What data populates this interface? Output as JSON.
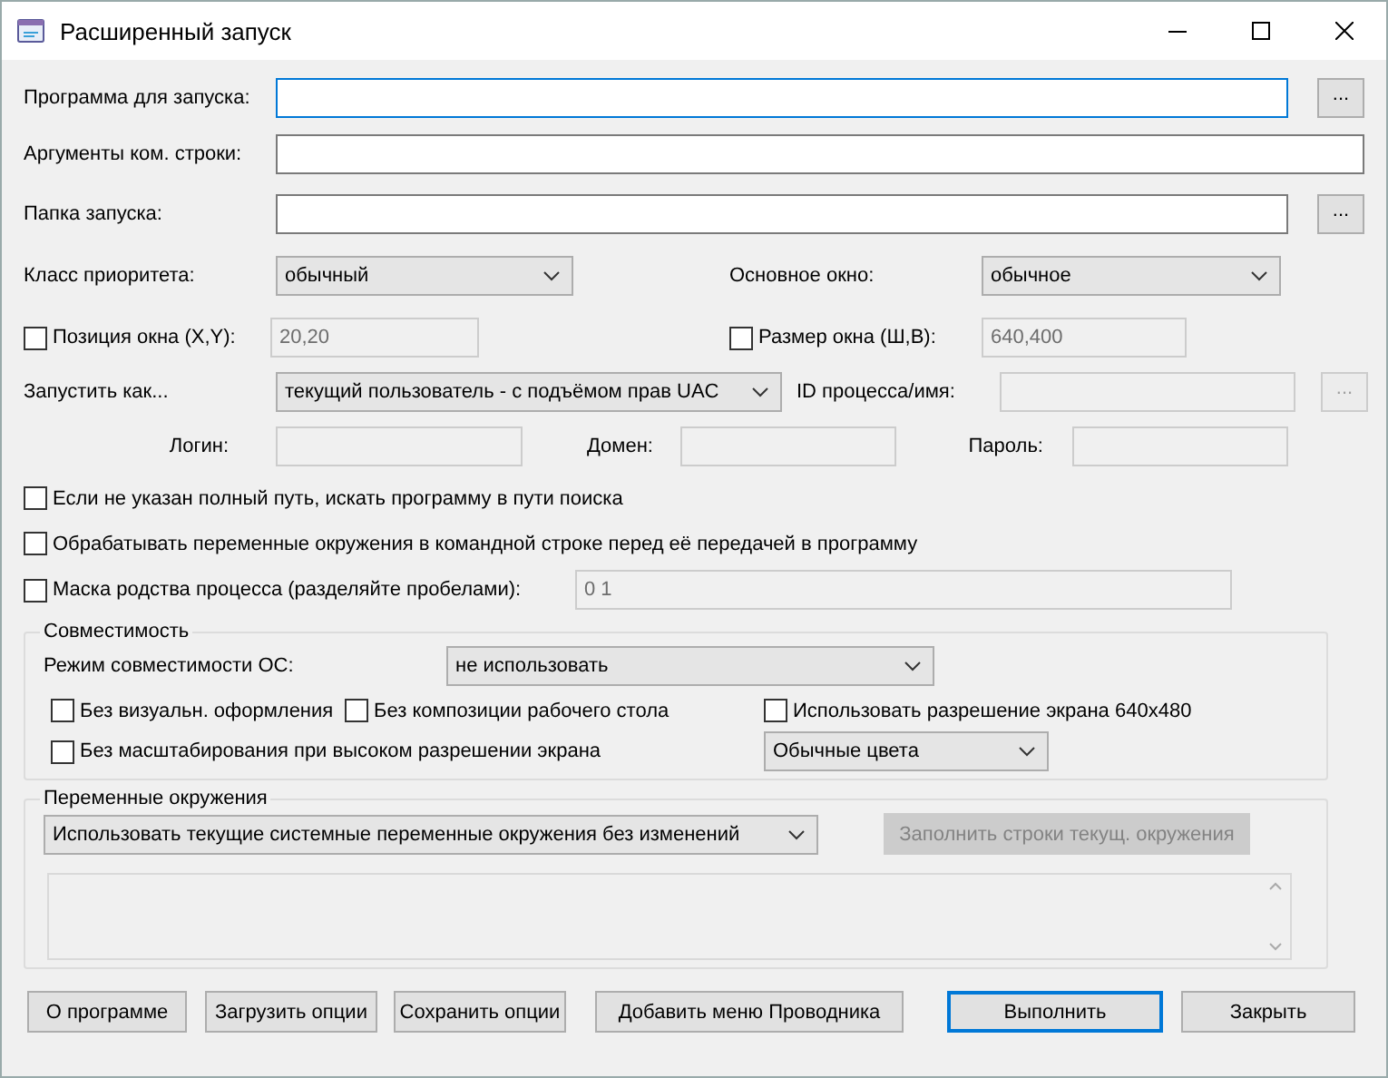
{
  "window": {
    "title": "Расширенный запуск"
  },
  "program": {
    "label": "Программа для запуска:",
    "focused": true,
    "browse": "..."
  },
  "arguments": {
    "label": "Аргументы ком. строки:",
    "focused": false
  },
  "folder": {
    "label": "Папка запуска:",
    "focused": false,
    "browse": "..."
  },
  "priority": {
    "label": "Класс приоритета:",
    "value": "обычный"
  },
  "main_window": {
    "label": "Основное окно:",
    "value": "обычное"
  },
  "position": {
    "label": "Позиция окна (X,Y):",
    "checked": false,
    "value": "20,20",
    "disabled": true
  },
  "size": {
    "label": "Размер окна (Ш,В):",
    "checked": false,
    "value": "640,400",
    "disabled": true
  },
  "run_as": {
    "label": "Запустить как...",
    "value": "текущий пользователь - с подъёмом прав UAC"
  },
  "process_id": {
    "label": "ID процесса/имя:",
    "disabled": true,
    "browse": "...",
    "browse_disabled": true
  },
  "credentials": [
    {
      "label": "Логин:",
      "disabled": true
    },
    {
      "label": "Домен:",
      "disabled": true
    },
    {
      "label": "Пароль:",
      "disabled": true
    }
  ],
  "options": [
    {
      "label": "Если не указан полный путь, искать программу в пути поиска",
      "checked": false
    },
    {
      "label": "Обрабатывать переменные окружения в командной строке перед её передачей в программу",
      "checked": false
    }
  ],
  "affinity": {
    "label": "Маска родства процесса (разделяйте пробелами):",
    "checked": false,
    "value": "0 1",
    "disabled": true
  },
  "compatibility": {
    "title": "Совместимость",
    "mode_label": "Режим совместимости ОС:",
    "mode": "не использовать",
    "checkboxes": [
      {
        "label": "Без визуальн. оформления",
        "checked": false
      },
      {
        "label": "Без композиции рабочего стола",
        "checked": false
      },
      {
        "label": "Использовать разрешение экрана 640x480",
        "checked": false
      },
      {
        "label": "Без масштабирования при высоком разрешении экрана",
        "checked": false
      }
    ],
    "colors": "Обычные цвета"
  },
  "environment": {
    "title": "Переменные окружения",
    "mode": "Использовать текущие системные переменные окружения без изменений",
    "fill_button": {
      "label": "Заполнить строки текущ. окружения",
      "disabled": true
    }
  },
  "buttons": [
    {
      "label": "О программе",
      "default": false
    },
    {
      "label": "Загрузить опции",
      "default": false
    },
    {
      "label": "Сохранить опции",
      "default": false
    },
    {
      "label": "Добавить меню Проводника",
      "default": false
    },
    {
      "label": "Выполнить",
      "default": true
    },
    {
      "label": "Закрыть",
      "default": false
    }
  ]
}
